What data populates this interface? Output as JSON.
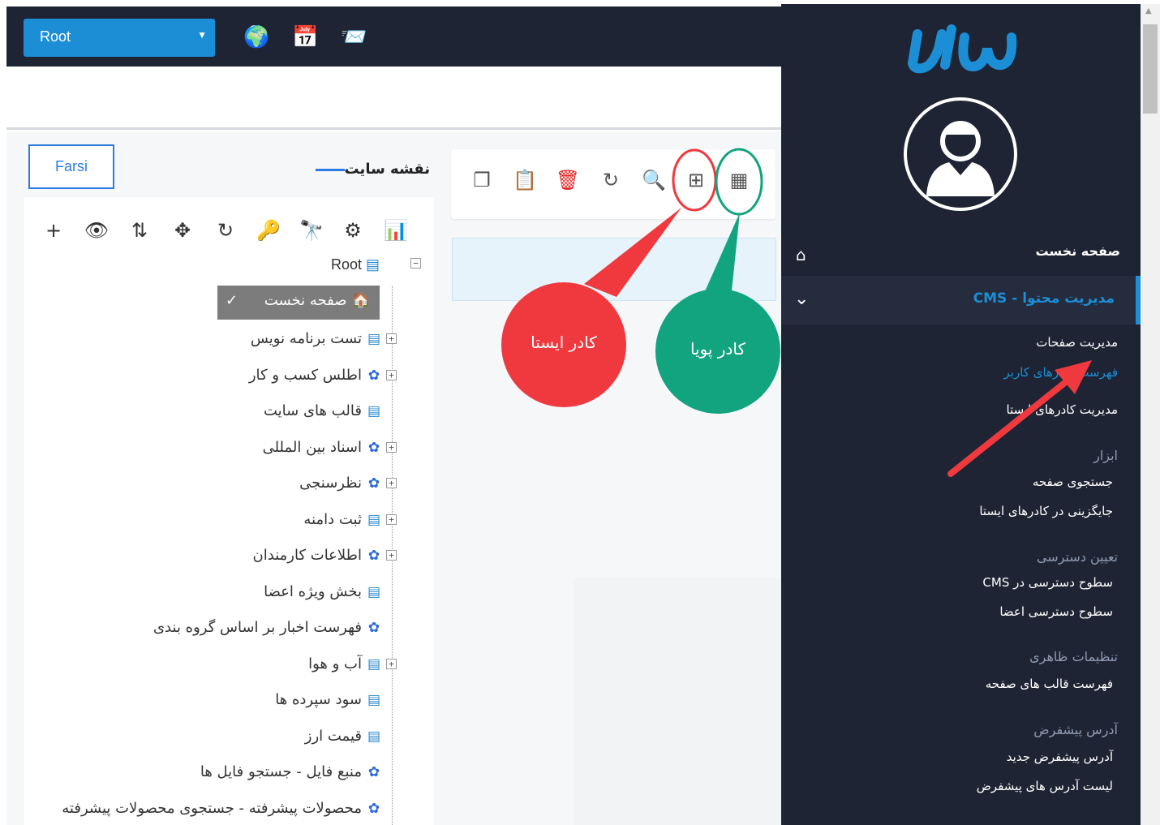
{
  "topbar": {
    "site_select_value": "Root",
    "icons": [
      "globe-icon",
      "calendar-icon",
      "mail-inbox-icon"
    ]
  },
  "language_button": "Farsi",
  "sitemap": {
    "title": "نقشه سایت",
    "toolbar_icons": [
      "add-icon",
      "view-icon",
      "sort-icon",
      "move-icon",
      "refresh-icon",
      "key-icon",
      "binoculars-icon",
      "settings-icon",
      "chart-icon"
    ],
    "root_label": "Root",
    "selected_node": "صفحه نخست",
    "nodes": [
      {
        "label": "تست برنامه نویس",
        "icon": "document"
      },
      {
        "label": "اطلس کسب و کار",
        "icon": "gear"
      },
      {
        "label": "قالب های سایت",
        "icon": "document"
      },
      {
        "label": "اسناد بین المللی",
        "icon": "gear"
      },
      {
        "label": "نظرسنجی",
        "icon": "gear"
      },
      {
        "label": "ثبت دامنه",
        "icon": "document"
      },
      {
        "label": "اطلاعات کارمندان",
        "icon": "gear"
      },
      {
        "label": "بخش ویژه اعضا",
        "icon": "document"
      },
      {
        "label": "فهرست اخبار بر اساس گروه بندی",
        "icon": "gear"
      },
      {
        "label": "آب و هوا",
        "icon": "document"
      },
      {
        "label": "سود سپرده ها",
        "icon": "document"
      },
      {
        "label": "قیمت ارز",
        "icon": "document"
      },
      {
        "label": "منبع فایل - جستجو فایل ها",
        "icon": "gear"
      },
      {
        "label": "محصولات پیشرفته - جستجوی محصولات پیشرفته",
        "icon": "gear"
      }
    ]
  },
  "actions": {
    "icons": [
      "copy-icon",
      "paste-icon",
      "delete-icon",
      "refresh-icon",
      "search-icon",
      "add-static-frame-icon",
      "add-dynamic-frame-icon"
    ]
  },
  "annotations": {
    "static_frame": "کادر ایستا",
    "dynamic_frame": "کادر پویا",
    "red_color": "#f0393e",
    "green_color": "#12a37f"
  },
  "sidebar": {
    "home": "صفحه نخست",
    "active_section": "مدیریت محتوا - CMS",
    "items": [
      {
        "label": "مدیریت صفحات",
        "type": "item"
      },
      {
        "label": "فهرست کادرهای کاربر",
        "type": "link"
      },
      {
        "label": "مدیریت کادرهای ایستا",
        "type": "item"
      },
      {
        "label": "ابزار",
        "type": "head"
      },
      {
        "label": "جستجوی صفحه",
        "type": "item"
      },
      {
        "label": "جایگزینی در کادرهای ایستا",
        "type": "item"
      },
      {
        "label": "تعیین دسترسی",
        "type": "head"
      },
      {
        "label": "سطوح دسترسی در CMS",
        "type": "item"
      },
      {
        "label": "سطوح دسترسی اعضا",
        "type": "item"
      },
      {
        "label": "تنظیمات ظاهری",
        "type": "head"
      },
      {
        "label": "فهرست قالب های صفحه",
        "type": "item"
      },
      {
        "label": "آدرس پیشفرض",
        "type": "head"
      },
      {
        "label": "آدرس پیشفرض جدید",
        "type": "item"
      },
      {
        "label": "لیست آدرس های پیشفرض",
        "type": "item"
      }
    ]
  },
  "colors": {
    "accent": "#1b8ed6",
    "dark": "#1e2433"
  }
}
